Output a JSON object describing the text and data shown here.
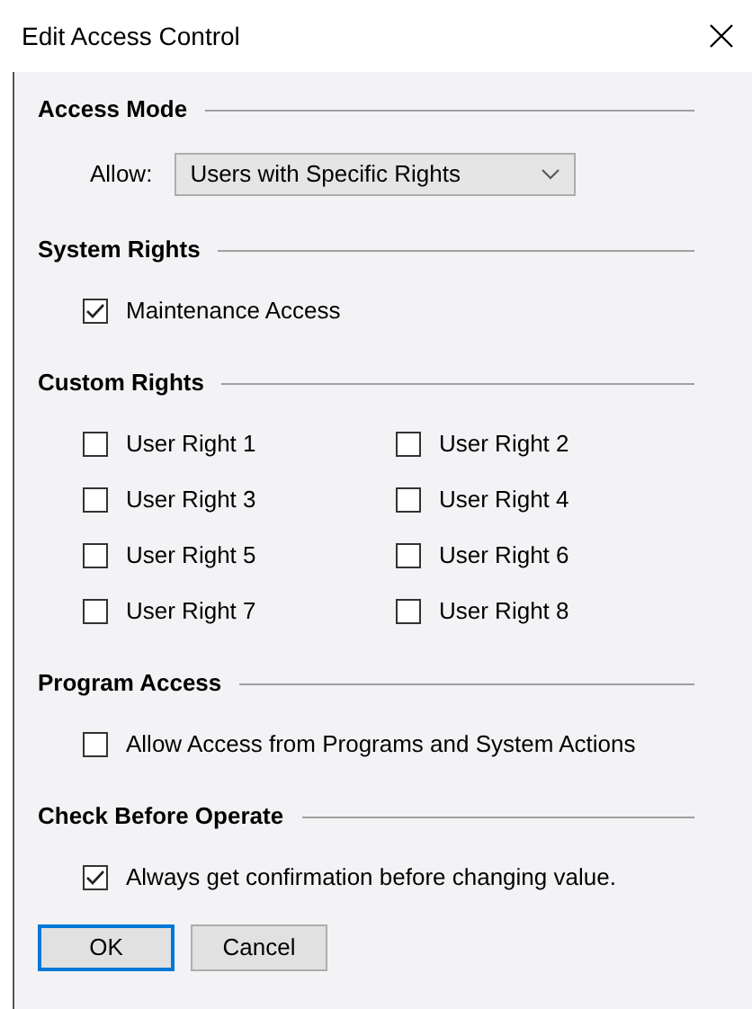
{
  "window": {
    "title": "Edit Access Control"
  },
  "sections": [
    {
      "heading": "Access Mode",
      "kind": "dropdown",
      "label": "Allow:",
      "value": "Users with Specific Rights"
    },
    {
      "heading": "System Rights",
      "kind": "checkboxes",
      "items": [
        {
          "label": "Maintenance Access",
          "checked": true
        }
      ]
    },
    {
      "heading": "Custom Rights",
      "kind": "checkbox-grid",
      "items": [
        {
          "label": "User Right 1",
          "checked": false
        },
        {
          "label": "User Right 2",
          "checked": false
        },
        {
          "label": "User Right 3",
          "checked": false
        },
        {
          "label": "User Right 4",
          "checked": false
        },
        {
          "label": "User Right 5",
          "checked": false
        },
        {
          "label": "User Right 6",
          "checked": false
        },
        {
          "label": "User Right 7",
          "checked": false
        },
        {
          "label": "User Right 8",
          "checked": false
        }
      ]
    },
    {
      "heading": "Program Access",
      "kind": "checkboxes",
      "items": [
        {
          "label": "Allow Access from Programs and System Actions",
          "checked": false
        }
      ]
    },
    {
      "heading": "Check Before Operate",
      "kind": "checkboxes",
      "items": [
        {
          "label": "Always get confirmation before changing value.",
          "checked": true
        }
      ]
    }
  ],
  "buttons": [
    {
      "label": "OK",
      "default": true
    },
    {
      "label": "Cancel",
      "default": false
    }
  ]
}
